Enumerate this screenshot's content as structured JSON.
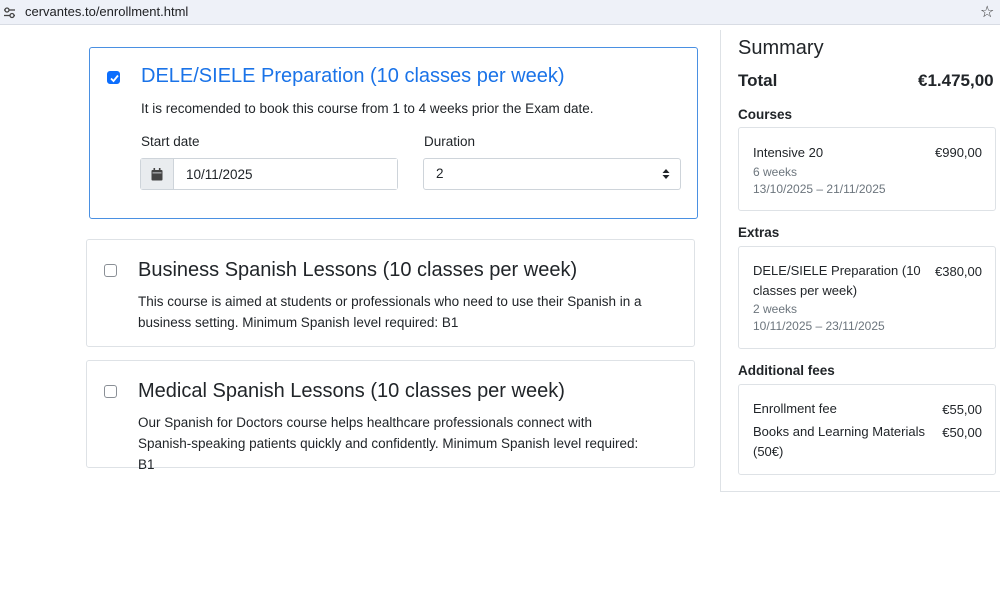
{
  "browser": {
    "url": "cervantes.to/enrollment.html",
    "icons": {
      "site": "tune-icon",
      "bookmark": "star-icon"
    }
  },
  "courses": [
    {
      "title": "DELE/SIELE Preparation (10 classes per week)",
      "description": "It is recomended to book this course from 1 to 4 weeks prior the Exam date.",
      "checked": true,
      "start_date_label": "Start date",
      "start_date_value": "10/11/2025",
      "duration_label": "Duration",
      "duration_value": "2"
    },
    {
      "title": "Business Spanish Lessons (10 classes per week)",
      "description": "This course is aimed at students or professionals who need to use their Spanish in a business setting. Minimum Spanish level required: B1",
      "checked": false
    },
    {
      "title": "Medical Spanish Lessons (10 classes per week)",
      "description": "Our Spanish for Doctors course helps healthcare professionals connect with Spanish-speaking patients quickly and confidently. Minimum Spanish level required: B1",
      "checked": false
    }
  ],
  "summary": {
    "title": "Summary",
    "total_label": "Total",
    "total_value": "€1.475,00",
    "courses_heading": "Courses",
    "course_item": {
      "name": "Intensive 20",
      "price": "€990,00",
      "weeks": "6 weeks",
      "dates": "13/10/2025 – 21/11/2025"
    },
    "extras_heading": "Extras",
    "extra_item": {
      "name": "DELE/SIELE Preparation (10 classes per week)",
      "price": "€380,00",
      "weeks": "2 weeks",
      "dates": "10/11/2025 – 23/11/2025"
    },
    "fees_heading": "Additional fees",
    "fees": [
      {
        "name": "Enrollment fee",
        "price": "€55,00"
      },
      {
        "name": "Books and Learning Materials (50€)",
        "price": "€50,00"
      }
    ]
  },
  "colors": {
    "accent": "#1a73e8",
    "checkbox": "#0d6efd",
    "border": "#dee2e6"
  }
}
